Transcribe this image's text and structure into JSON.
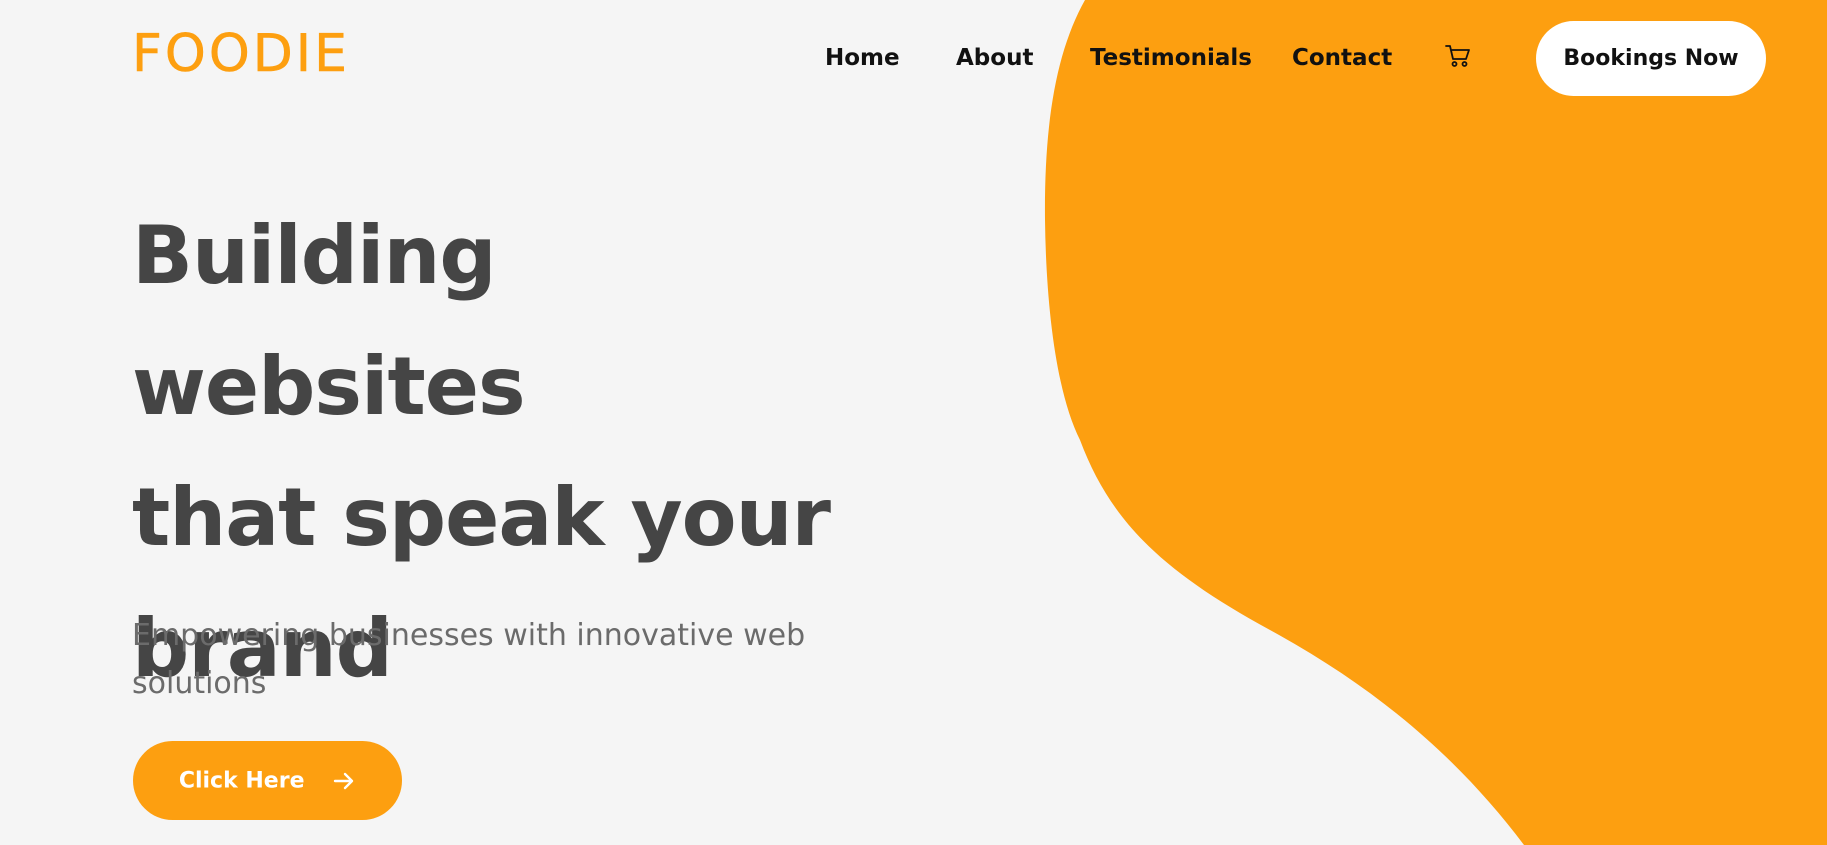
{
  "brand": {
    "logo_text": "FOODIE"
  },
  "nav": {
    "links": [
      "Home",
      "About",
      "Testimonials",
      "Contact"
    ],
    "cart_icon": "shopping-cart-icon",
    "cta_label": "Bookings Now"
  },
  "hero": {
    "title_lines": [
      "Building websites",
      "that speak your",
      "brand"
    ],
    "subtitle": "Empowering businesses with innovative web solutions",
    "button_label": "Click Here",
    "button_icon": "arrow-right-icon"
  },
  "colors": {
    "accent": "#fd9f10",
    "background": "#f5f5f5",
    "heading": "#454545",
    "subtitle": "#6b6b6b",
    "nav_text": "#111111"
  }
}
